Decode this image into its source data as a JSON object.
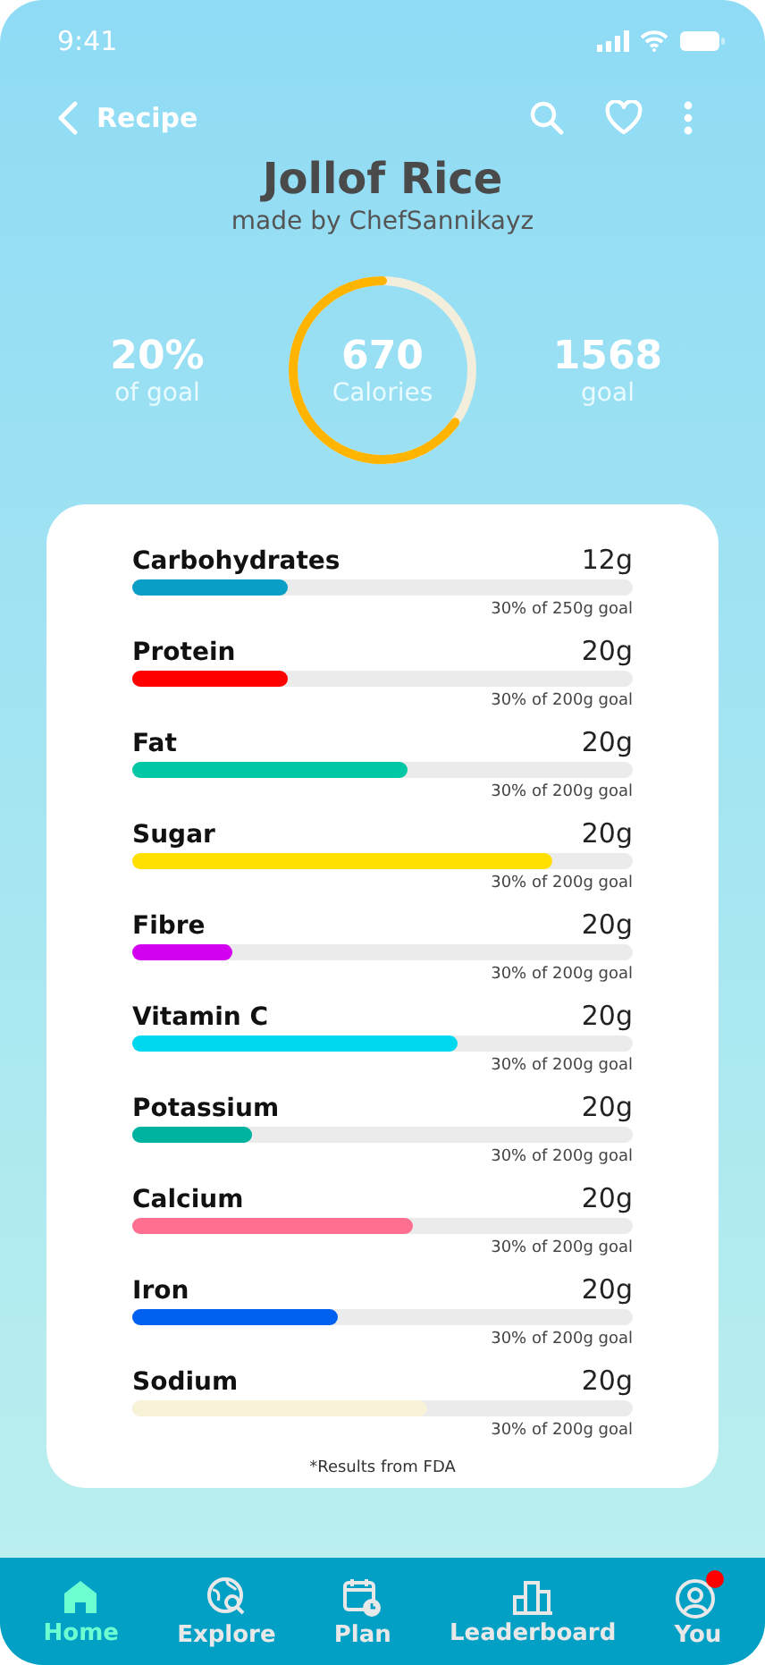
{
  "status_bar": {
    "time": "9:41"
  },
  "header": {
    "back_label": "Recipe"
  },
  "recipe": {
    "title": "Jollof Rice",
    "author": "made by ChefSannikayz"
  },
  "summary": {
    "left_value": "20%",
    "left_label": "of goal",
    "ring_value": "670",
    "ring_label": "Calories",
    "level": 0.65,
    "right_value": "1568",
    "right_label": "goal"
  },
  "nutrients": [
    {
      "name": "Carbohydrates",
      "amount": "12g",
      "level": 0.31,
      "color": "#0a9fc7",
      "goal": "30% of 250g goal"
    },
    {
      "name": "Protein",
      "amount": "20g",
      "level": 0.31,
      "color": "#ff0000",
      "goal": "30% of 200g goal"
    },
    {
      "name": "Fat",
      "amount": "20g",
      "level": 0.55,
      "color": "#00c8a5",
      "goal": "30% of 200g goal"
    },
    {
      "name": "Sugar",
      "amount": "20g",
      "level": 0.84,
      "color": "#ffe000",
      "goal": "30% of 200g goal"
    },
    {
      "name": "Fibre",
      "amount": "20g",
      "level": 0.2,
      "color": "#d400f0",
      "goal": "30% of 200g goal"
    },
    {
      "name": "Vitamin C",
      "amount": "20g",
      "level": 0.65,
      "color": "#00d8f0",
      "goal": "30% of 200g goal"
    },
    {
      "name": "Potassium",
      "amount": "20g",
      "level": 0.24,
      "color": "#00b2a0",
      "goal": "30% of 200g goal"
    },
    {
      "name": "Calcium",
      "amount": "20g",
      "level": 0.56,
      "color": "#ff7090",
      "goal": "30% of 200g goal"
    },
    {
      "name": "Iron",
      "amount": "20g",
      "level": 0.41,
      "color": "#0060f0",
      "goal": "30% of 200g goal"
    },
    {
      "name": "Sodium",
      "amount": "20g",
      "level": 0.59,
      "color": "#f7f2d8",
      "goal": "30% of 200g goal"
    }
  ],
  "footnote": "*Results from FDA",
  "tabs": [
    {
      "kind": "home",
      "label": "Home",
      "selected": true
    },
    {
      "kind": "explore",
      "label": "Explore",
      "selected": false
    },
    {
      "kind": "plan",
      "label": "Plan",
      "selected": false
    },
    {
      "kind": "leaderboard",
      "label": "Leaderboard",
      "selected": false
    },
    {
      "kind": "you",
      "label": "You",
      "selected": false,
      "badge": true
    }
  ]
}
